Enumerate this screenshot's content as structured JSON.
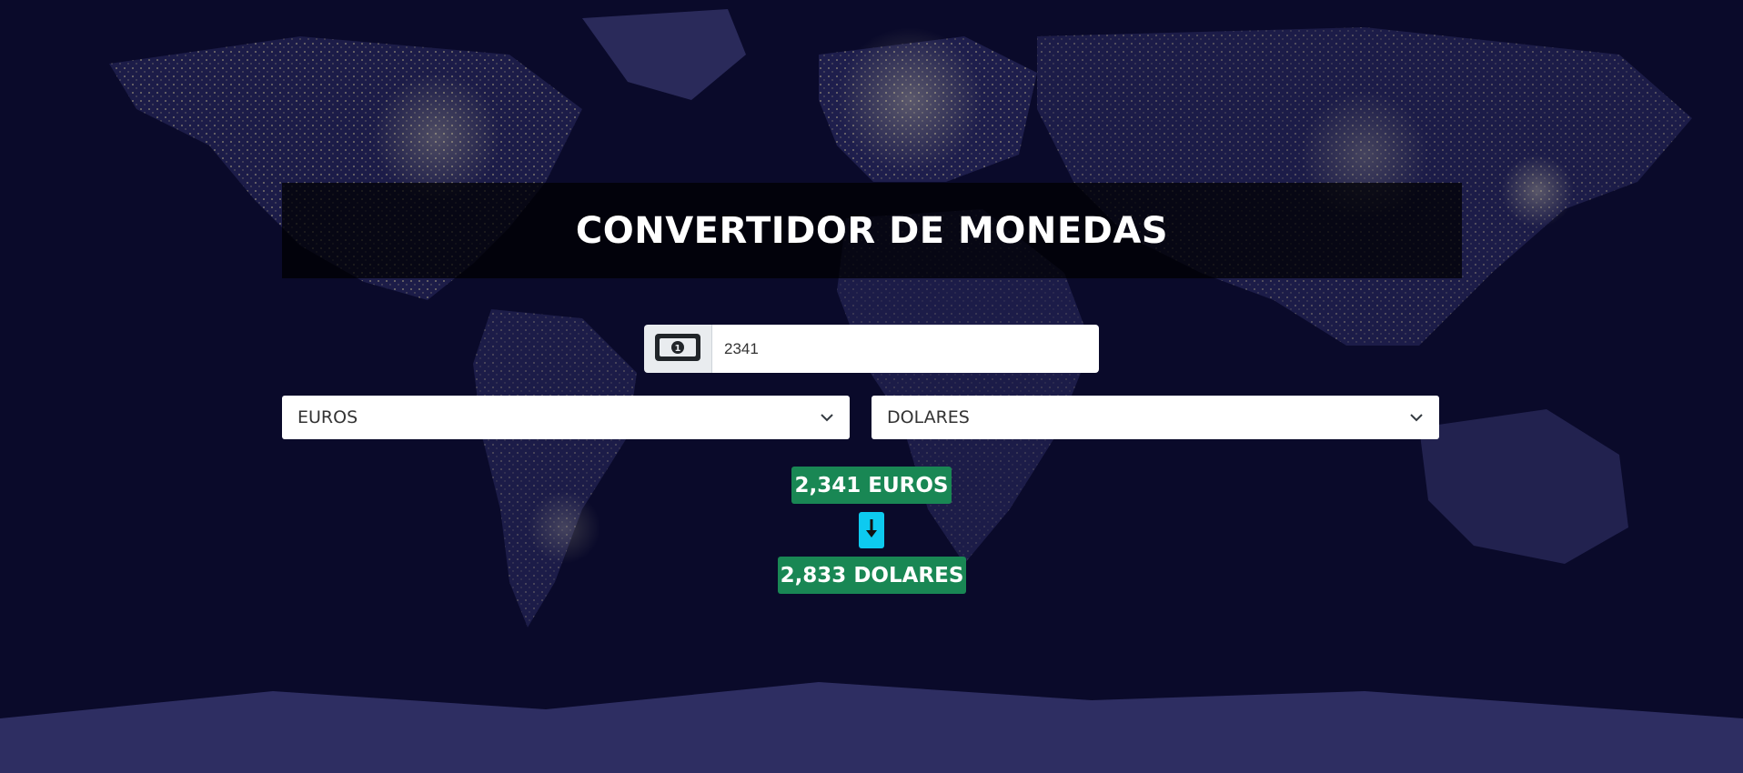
{
  "header": {
    "title": "CONVERTIDOR DE MONEDAS"
  },
  "amount": {
    "icon": "money-bill-icon",
    "value": "2341"
  },
  "selects": {
    "from": "EUROS",
    "to": "DOLARES"
  },
  "result": {
    "from_text": "2,341 EUROS",
    "arrow_icon": "arrow-down-icon",
    "to_text": "2,833 DOLARES"
  },
  "colors": {
    "background": "#0c0c2c",
    "title_band": "#000000",
    "result_badge": "#198754",
    "arrow_badge": "#0dcaf0"
  }
}
